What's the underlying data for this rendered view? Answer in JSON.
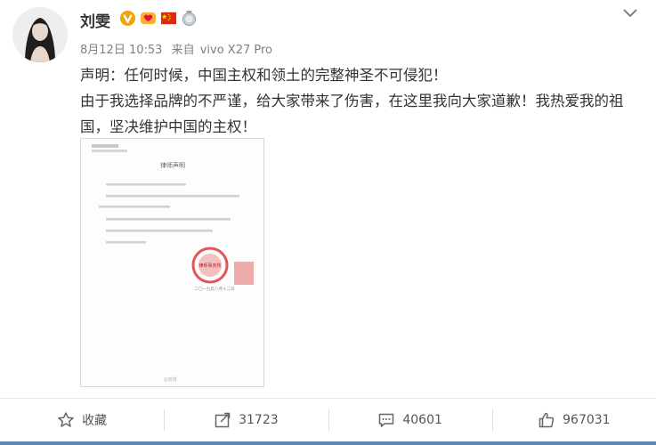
{
  "post": {
    "username": "刘雯",
    "time": "8月12日 10:53",
    "source_prefix": "来自",
    "source": "vivo X27 Pro",
    "content": [
      "声明：任何时候，中国主权和领土的完整神圣不可侵犯！",
      "由于我选择品牌的不严谨，给大家带来了伤害，在这里我向大家道歉！我热爱我的祖国，坚决维护中国的主权！"
    ],
    "badges": [
      "verified-v-icon",
      "fan-badge-icon",
      "china-flag-icon",
      "medal-icon"
    ],
    "image": {
      "title": "律师声明",
      "stamp_text": "律师事务所",
      "date_line": "二〇一九年八月十二日",
      "watermark": "@微博"
    }
  },
  "actions": {
    "favorite_label": "收藏",
    "forward_count": "31723",
    "comment_count": "40601",
    "like_count": "967031"
  },
  "colors": {
    "accent": "#e6162d",
    "bottom_bar": "#5f87b4",
    "verified": "#f0a30a"
  }
}
